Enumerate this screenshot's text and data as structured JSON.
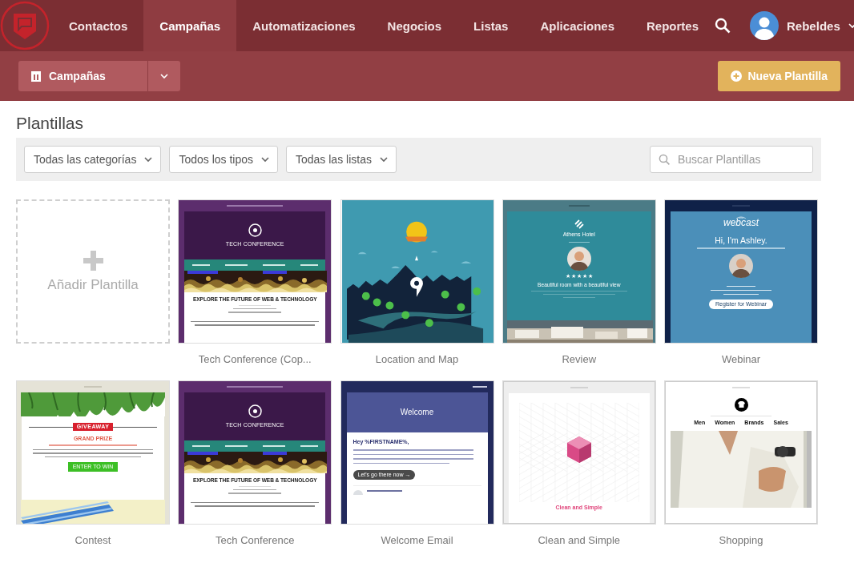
{
  "header": {
    "nav": [
      {
        "label": "Contactos",
        "selected": false
      },
      {
        "label": "Campañas",
        "selected": true
      },
      {
        "label": "Automatizaciones",
        "selected": false
      },
      {
        "label": "Negocios",
        "selected": false
      },
      {
        "label": "Listas",
        "selected": false
      },
      {
        "label": "Aplicaciones",
        "selected": false
      },
      {
        "label": "Reportes",
        "selected": false
      }
    ],
    "user": {
      "name": "Rebeldes"
    }
  },
  "toolbar": {
    "section_button": "Campañas",
    "new_button": "Nueva Plantilla"
  },
  "page_title": "Plantillas",
  "filters": {
    "dropdowns": [
      "Todas las categorías",
      "Todos los tipos",
      "Todas las listas"
    ],
    "search": {
      "placeholder": "Buscar Plantillas"
    }
  },
  "add_card": {
    "label": "Añadir Plantilla"
  },
  "templates": [
    {
      "name": "Tech Conference (Cop...",
      "kind": "tech",
      "preview": {
        "title": "TECH CONFERENCE",
        "headline": "EXPLORE THE FUTURE OF WEB & TECHNOLOGY"
      }
    },
    {
      "name": "Location and Map",
      "kind": "map"
    },
    {
      "name": "Review",
      "kind": "review",
      "preview": {
        "hotel": "Athens Hotel",
        "stars": 5,
        "headline": "Beautiful room with a beautiful view"
      }
    },
    {
      "name": "Webinar",
      "kind": "webinar",
      "preview": {
        "logo": "webcast",
        "greeting": "Hi, I'm Ashley.",
        "button": "Register for Webinar"
      }
    },
    {
      "name": "Contest",
      "kind": "contest",
      "preview": {
        "badge": "GIVEAWAY",
        "prize_title": "GRAND PRIZE",
        "button": "ENTER TO WIN"
      }
    },
    {
      "name": "Tech Conference",
      "kind": "tech",
      "preview": {
        "title": "TECH CONFERENCE",
        "headline": "EXPLORE THE FUTURE OF WEB & TECHNOLOGY"
      }
    },
    {
      "name": "Welcome Email",
      "kind": "welcome",
      "preview": {
        "title": "Welcome",
        "greeting": "Hey %FIRSTNAME%,",
        "button": "Let's go there now →"
      }
    },
    {
      "name": "Clean and Simple",
      "kind": "clean",
      "preview": {
        "title": "Clean and Simple"
      }
    },
    {
      "name": "Shopping",
      "kind": "shopping",
      "preview": {
        "menu": [
          "Men",
          "Women",
          "Brands",
          "Sales"
        ]
      }
    }
  ]
}
